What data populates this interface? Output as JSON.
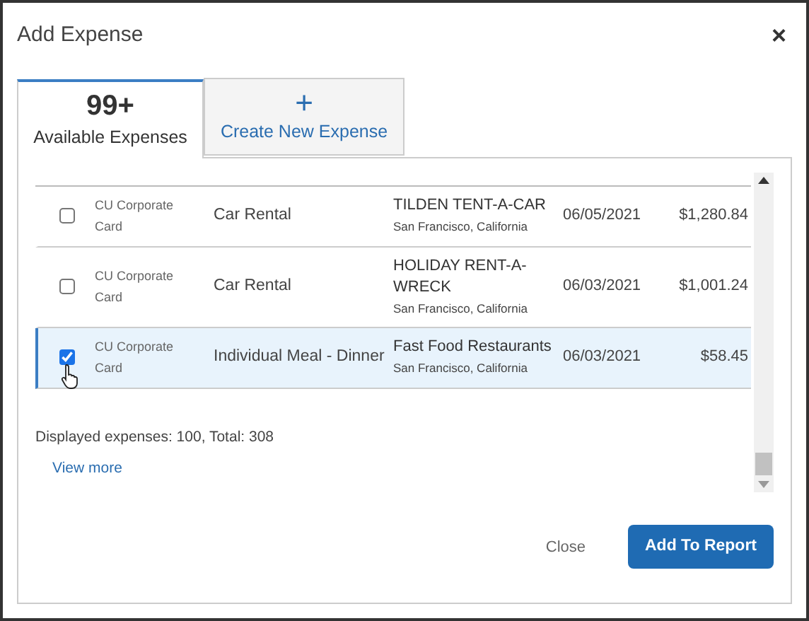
{
  "window": {
    "title": "Add Expense",
    "close": "×"
  },
  "tabs": [
    {
      "kind": "count",
      "top": "99+",
      "label": "Available Expenses",
      "selected": true
    },
    {
      "kind": "create",
      "top": "+",
      "label": "Create New Expense",
      "selected": false
    }
  ],
  "table": {
    "rows": [
      {
        "checked": false,
        "source": "CU Corporate Card",
        "type": "Car Rental",
        "merchant": "TILDEN TENT-A-CAR",
        "location": "San Francisco, California",
        "date": "06/05/2021",
        "amount": "$1,280.84"
      },
      {
        "checked": false,
        "source": "CU Corporate Card",
        "type": "Car Rental",
        "merchant": "HOLIDAY RENT-A-WRECK",
        "location": "San Francisco, California",
        "date": "06/03/2021",
        "amount": "$1,001.24"
      },
      {
        "checked": true,
        "source": "CU Corporate Card",
        "type": "Individual Meal - Dinner",
        "merchant": "Fast Food Restaurants",
        "location": "San Francisco, California",
        "date": "06/03/2021",
        "amount": "$58.45"
      }
    ]
  },
  "summary": "Displayed expenses: 100, Total: 308",
  "view_more": "View more",
  "buttons": {
    "close": "Close",
    "add": "Add To Report"
  }
}
